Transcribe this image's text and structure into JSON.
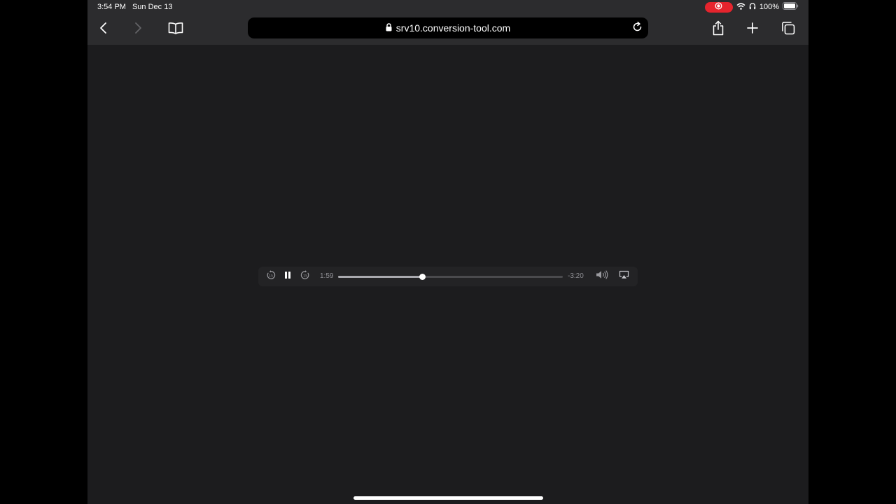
{
  "status_bar": {
    "time": "3:54 PM",
    "date": "Sun Dec 13",
    "battery": "100%",
    "icons": [
      "record-icon",
      "wifi-icon",
      "headphones-icon",
      "battery-icon"
    ]
  },
  "toolbar": {
    "url": "srv10.conversion-tool.com",
    "icons": [
      "back-icon",
      "forward-icon",
      "bookmarks-icon",
      "lock-icon",
      "reload-icon",
      "share-icon",
      "plus-icon",
      "tabs-icon"
    ]
  },
  "player": {
    "elapsed": "1:59",
    "remaining": "-3:20",
    "progress_fraction": 0.375,
    "icons": [
      "skip-back-15-icon",
      "pause-icon",
      "skip-forward-15-icon",
      "volume-icon",
      "airplay-icon"
    ]
  },
  "colors": {
    "page_bg": "#1c1c1e",
    "bar_bg": "#2c2c2e",
    "record_red": "#e5242d"
  }
}
